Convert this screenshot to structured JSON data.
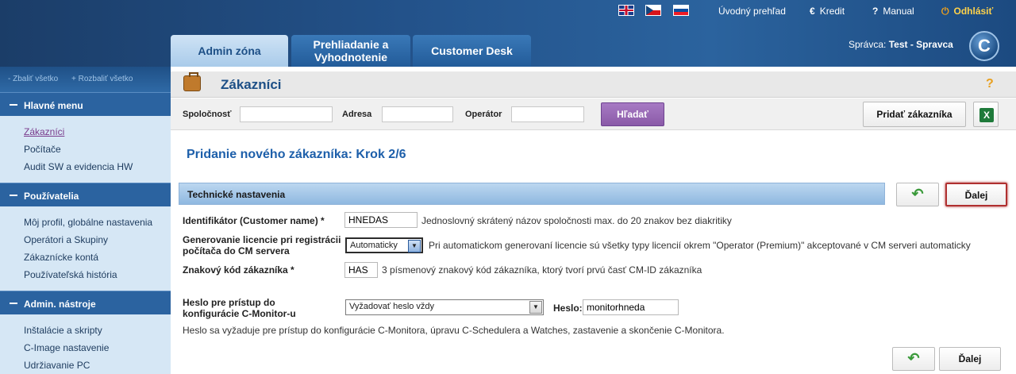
{
  "header": {
    "links": {
      "home": "Úvodný prehľad",
      "credit": "Kredit",
      "manual": "Manual",
      "logout": "Odhlásiť"
    },
    "tabs": [
      "Admin zóna",
      "Prehliadanie a Vyhodnotenie",
      "Customer Desk"
    ],
    "admin_label": "Správca:",
    "admin_name": "Test - Spravca",
    "logo_letter": "C"
  },
  "sidebar": {
    "collapse_all": "- Zbaliť všetko",
    "expand_all": "+ Rozbaliť všetko",
    "sections": [
      {
        "title": "Hlavné menu",
        "items": [
          "Zákazníci",
          "Počítače",
          "Audit SW a evidencia HW"
        ]
      },
      {
        "title": "Používatelia",
        "items": [
          "Môj profil, globálne nastavenia",
          "Operátori a Skupiny",
          "Zákaznícke kontá",
          "Používateľská história"
        ]
      },
      {
        "title": "Admin. nástroje",
        "items": [
          "Inštalácie a skripty",
          "C-Image nastavenie",
          "Udržiavanie PC"
        ]
      }
    ],
    "active_item": "Zákazníci"
  },
  "main": {
    "page_title": "Zákazníci",
    "help": "?",
    "filters": {
      "company_label": "Spoločnosť",
      "address_label": "Adresa",
      "operator_label": "Operátor",
      "search_button": "Hľadať",
      "add_button": "Pridať zákazníka",
      "excel_icon_label": "X"
    },
    "step_title": "Pridanie nového zákazníka: Krok 2/6",
    "section_title": "Technické nastavenia",
    "next_label": "Ďalej",
    "rows": {
      "identifier_label": "Identifikátor (Customer name) *",
      "identifier_value": "HNEDAS",
      "identifier_desc": "Jednoslovný skrátený názov spoločnosti max. do 20 znakov bez diakritiky",
      "license_label": "Generovanie licencie pri registrácii počítača do CM servera",
      "license_value": "Automaticky",
      "license_desc": "Pri automatickom generovaní licencie sú všetky typy licencií okrem \"Operator (Premium)\" akceptované v CM serveri automaticky",
      "code_label": "Znakový kód zákazníka *",
      "code_value": "HAS",
      "code_desc": "3 písmenový znakový kód zákazníka, ktorý tvorí prvú časť CM-ID zákazníka",
      "password_access_label": "Heslo pre prístup do konfigurácie C-Monitor-u",
      "password_mode_value": "Vyžadovať heslo vždy",
      "password_label": "Heslo:",
      "password_value": "monitorhneda",
      "password_note": "Heslo sa vyžaduje pre prístup do konfigurácie C-Monitora, úpravu C-Schedulera a Watches, zastavenie a skončenie C-Monitora."
    }
  },
  "colors": {
    "header_blue": "#23528a",
    "accent_purple": "#8a5aa8",
    "link_blue": "#1d5faa",
    "highlight_red": "#b03030"
  }
}
